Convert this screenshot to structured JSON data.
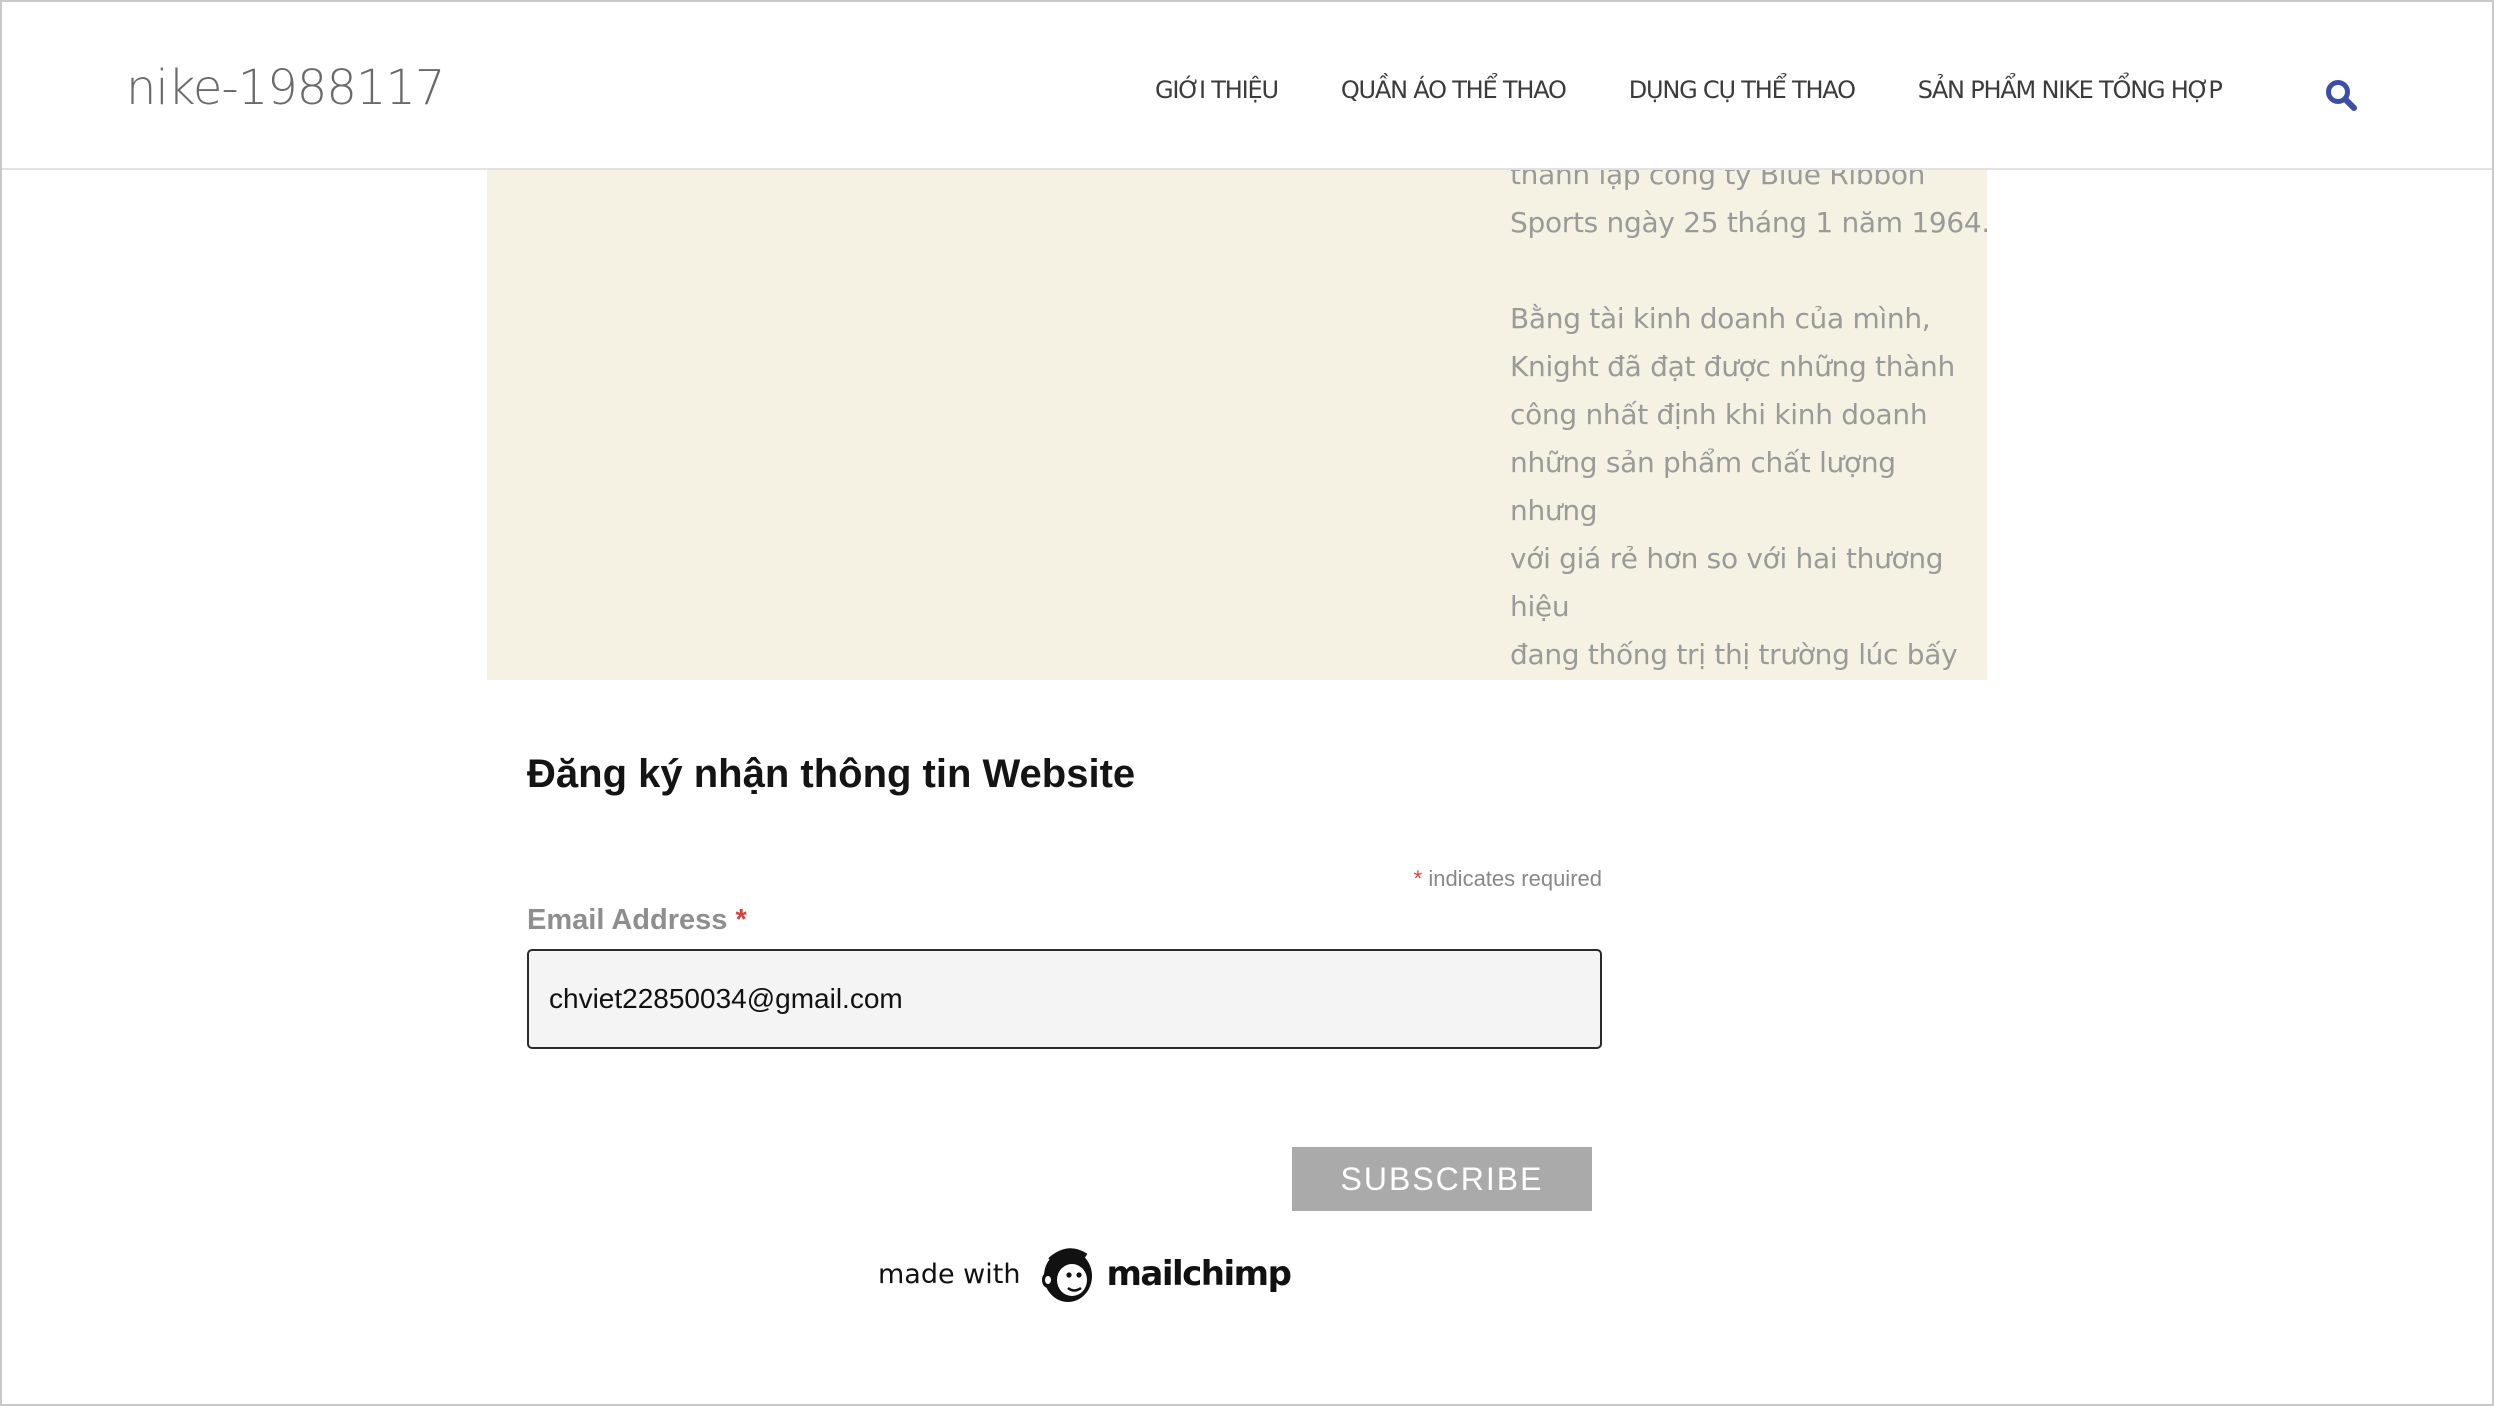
{
  "header": {
    "site_title": "nike-1988117",
    "nav": [
      {
        "label": "GIỚI THIỆU"
      },
      {
        "label": "QUẦN ÁO THỂ THAO"
      },
      {
        "label": "DỤNG CỤ THỂ THAO"
      },
      {
        "label": "SẢN PHẨM NIKE TỔNG HỢP"
      }
    ],
    "search_icon": "search-icon",
    "accent_color": "#3b4ea8"
  },
  "about": {
    "paragraph_1": "thành lập công ty Blue Ribbon\nSports ngày 25 tháng 1 năm 1964.",
    "paragraph_2": "Bằng tài kinh doanh của mình,\nKnight đã đạt được những thành\ncông nhất định khi kinh doanh\nnhững sản phẩm chất lượng nhưng\nvới giá rẻ hơn so với hai thương hiệu\nđang thống trị thị trường lúc bấy giờ\nlà Adidas và Puma",
    "background_color": "#f5f2e3"
  },
  "signup": {
    "title": "Đăng ký nhận thông tin Website",
    "required_asterisk": "*",
    "required_note": "indicates required",
    "email_label": "Email Address",
    "email_label_asterisk": "*",
    "email_value": "chviet22850034@gmail.com",
    "subscribe_label": "SUBSCRIBE"
  },
  "footer": {
    "made_with": "made with",
    "brand": "mailchimp",
    "brand_icon": "mailchimp-freddie-icon"
  }
}
